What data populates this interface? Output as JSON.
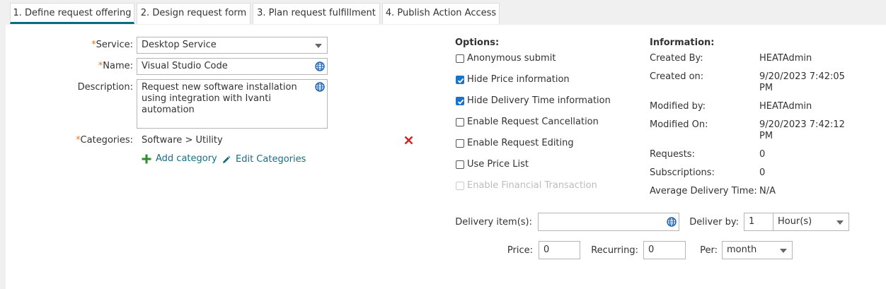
{
  "tabs": [
    {
      "label": "1. Define request offering"
    },
    {
      "label": "2. Design request form"
    },
    {
      "label": "3. Plan request fulfillment"
    },
    {
      "label": "4. Publish Action Access"
    }
  ],
  "form": {
    "required_marker": "*",
    "service_label": "Service:",
    "service_value": "Desktop Service",
    "name_label": "Name:",
    "name_value": "Visual Studio Code",
    "description_label": "Description:",
    "description_value": "Request new software installation using integration with Ivanti automation",
    "categories_label": "Categories:",
    "categories_value": "Software > Utility",
    "add_category": "Add category",
    "edit_categories": "Edit Categories"
  },
  "options": {
    "title": "Options:",
    "items": [
      {
        "label": "Anonymous submit",
        "checked": false,
        "disabled": false
      },
      {
        "label": "Hide Price information",
        "checked": true,
        "disabled": false
      },
      {
        "label": "Hide Delivery Time information",
        "checked": true,
        "disabled": false
      },
      {
        "label": "Enable Request Cancellation",
        "checked": false,
        "disabled": false
      },
      {
        "label": "Enable Request Editing",
        "checked": false,
        "disabled": false
      },
      {
        "label": "Use Price List",
        "checked": false,
        "disabled": false
      },
      {
        "label": "Enable Financial Transaction",
        "checked": false,
        "disabled": true
      }
    ]
  },
  "information": {
    "title": "Information:",
    "rows": [
      {
        "label": "Created By:",
        "value": "HEATAdmin"
      },
      {
        "label": "Created on:",
        "value": "9/20/2023 7:42:05 PM"
      },
      {
        "label": "Modified by:",
        "value": "HEATAdmin"
      },
      {
        "label": "Modified On:",
        "value": "9/20/2023 7:42:12 PM"
      },
      {
        "label": "Requests:",
        "value": "0"
      },
      {
        "label": "Subscriptions:",
        "value": "0"
      },
      {
        "label": "Average Delivery Time:",
        "value": "N/A"
      }
    ]
  },
  "delivery": {
    "items_label": "Delivery item(s):",
    "items_value": "",
    "deliver_by_label": "Deliver by:",
    "deliver_by_value": "1",
    "deliver_by_unit": "Hour(s)",
    "price_label": "Price:",
    "price_value": "0",
    "recurring_label": "Recurring:",
    "recurring_value": "0",
    "per_label": "Per:",
    "per_value": "month"
  },
  "colors": {
    "accent": "#0c6b80",
    "required": "#e07b2f",
    "link": "#1a6d80",
    "remove": "#d32020",
    "add": "#2e8b2e",
    "checked": "#1a73c8"
  }
}
